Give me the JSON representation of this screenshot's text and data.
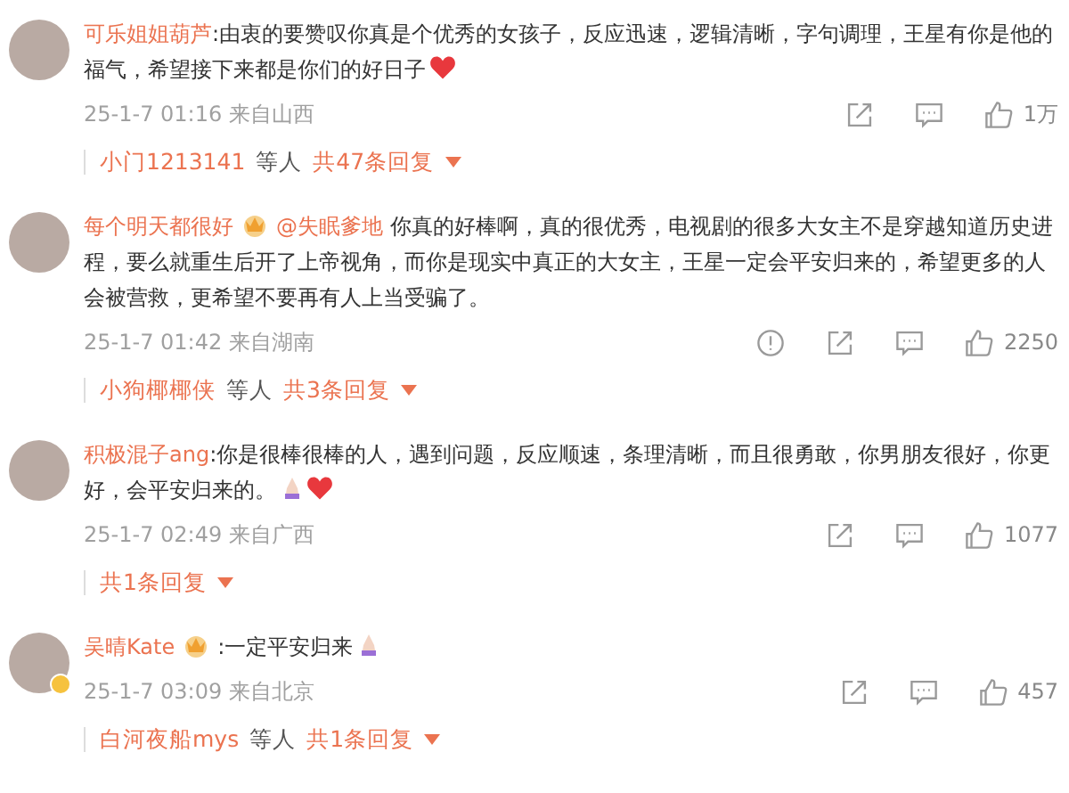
{
  "comments": [
    {
      "name": "可乐姐姐葫芦",
      "crown": false,
      "verified": false,
      "text": ":由衷的要赞叹你真是个优秀的女孩子，反应迅速，逻辑清晰，字句调理，王星有你是他的福气，希望接下来都是你们的好日子",
      "emojis": [
        {
          "kind": "heart"
        }
      ],
      "time": "25-1-7 01:16",
      "location": "来自山西",
      "actions": [
        {
          "kind": "share"
        },
        {
          "kind": "comment"
        },
        {
          "kind": "like",
          "count": "1万"
        }
      ],
      "replies": {
        "users": "小门1213141",
        "suffix": "等人",
        "total": "共47条回复"
      }
    },
    {
      "name": "每个明天都很好",
      "crown": true,
      "verified": false,
      "mention": "@失眠爹地",
      "text": "你真的好棒啊，真的很优秀，电视剧的很多大女主不是穿越知道历史进程，要么就重生后开了上帝视角，而你是现实中真正的大女主，王星一定会平安归来的，希望更多的人会被营救，更希望不要再有人上当受骗了。",
      "time": "25-1-7 01:42",
      "location": "来自湖南",
      "actions": [
        {
          "kind": "report"
        },
        {
          "kind": "share"
        },
        {
          "kind": "comment"
        },
        {
          "kind": "like",
          "count": "2250"
        }
      ],
      "replies": {
        "users": "小狗椰椰侠",
        "suffix": "等人",
        "total": "共3条回复"
      }
    },
    {
      "name": "积极混子ang",
      "crown": false,
      "verified": false,
      "text": ":你是很棒很棒的人，遇到问题，反应顺速，条理清晰，而且很勇敢，你男朋友很好，你更好，会平安归来的。",
      "emojis": [
        {
          "kind": "pray"
        },
        {
          "kind": "heart"
        }
      ],
      "time": "25-1-7 02:49",
      "location": "来自广西",
      "actions": [
        {
          "kind": "share"
        },
        {
          "kind": "comment"
        },
        {
          "kind": "like",
          "count": "1077"
        }
      ],
      "replies": {
        "total": "共1条回复"
      }
    },
    {
      "name": "吴晴Kate",
      "crown": true,
      "verified": true,
      "text": ":一定平安归来",
      "emojis": [
        {
          "kind": "pray"
        }
      ],
      "time": "25-1-7 03:09",
      "location": "来自北京",
      "actions": [
        {
          "kind": "share"
        },
        {
          "kind": "comment"
        },
        {
          "kind": "like",
          "count": "457"
        }
      ],
      "replies": {
        "users": "白河夜船mys",
        "suffix": "等人",
        "total": "共1条回复"
      }
    }
  ]
}
